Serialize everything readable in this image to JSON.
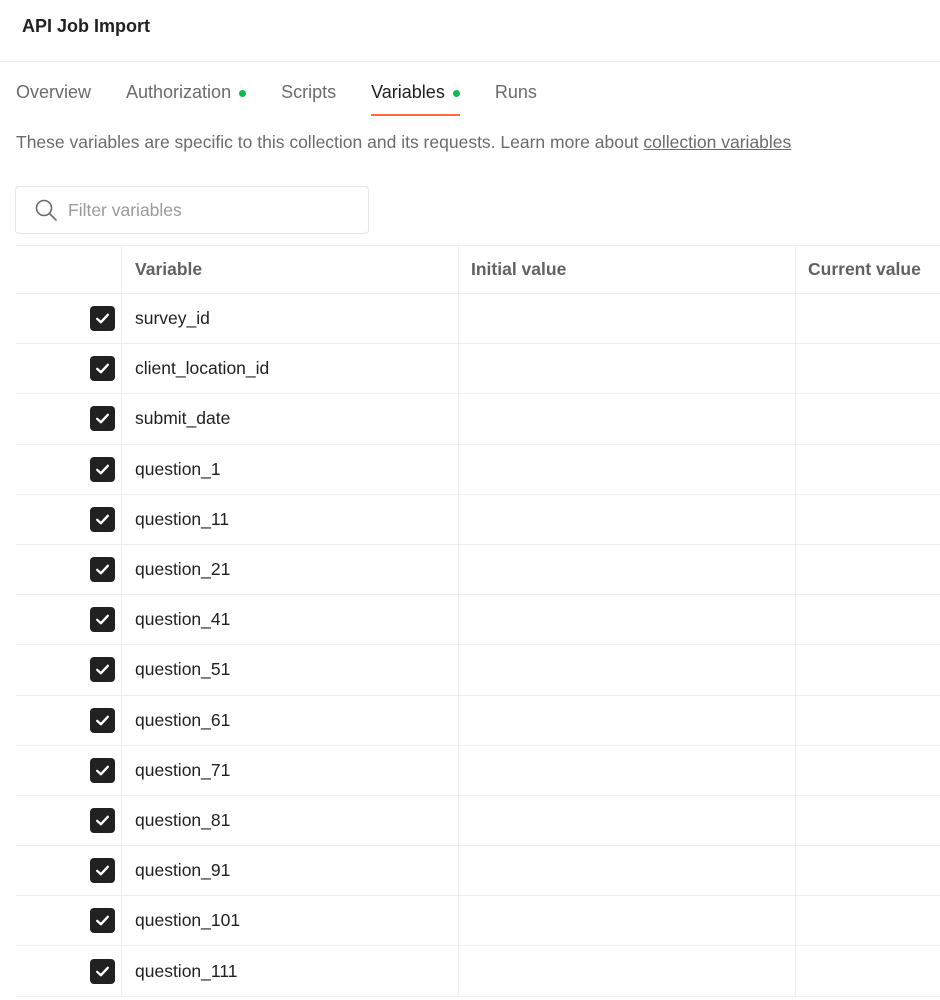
{
  "header": {
    "title": "API Job Import"
  },
  "tabs": [
    {
      "label": "Overview",
      "dot": false,
      "active": false
    },
    {
      "label": "Authorization",
      "dot": true,
      "active": false
    },
    {
      "label": "Scripts",
      "dot": false,
      "active": false
    },
    {
      "label": "Variables",
      "dot": true,
      "active": true
    },
    {
      "label": "Runs",
      "dot": false,
      "active": false
    }
  ],
  "description": {
    "text": "These variables are specific to this collection and its requests. Learn more about ",
    "link": "collection variables"
  },
  "filter": {
    "placeholder": "Filter variables",
    "value": ""
  },
  "table": {
    "columns": [
      "Variable",
      "Initial value",
      "Current value"
    ],
    "rows": [
      {
        "checked": true,
        "variable": "survey_id",
        "initial": "",
        "current": ""
      },
      {
        "checked": true,
        "variable": "client_location_id",
        "initial": "",
        "current": ""
      },
      {
        "checked": true,
        "variable": "submit_date",
        "initial": "",
        "current": ""
      },
      {
        "checked": true,
        "variable": "question_1",
        "initial": "",
        "current": ""
      },
      {
        "checked": true,
        "variable": "question_11",
        "initial": "",
        "current": ""
      },
      {
        "checked": true,
        "variable": "question_21",
        "initial": "",
        "current": ""
      },
      {
        "checked": true,
        "variable": "question_41",
        "initial": "",
        "current": ""
      },
      {
        "checked": true,
        "variable": "question_51",
        "initial": "",
        "current": ""
      },
      {
        "checked": true,
        "variable": "question_61",
        "initial": "",
        "current": ""
      },
      {
        "checked": true,
        "variable": "question_71",
        "initial": "",
        "current": ""
      },
      {
        "checked": true,
        "variable": "question_81",
        "initial": "",
        "current": ""
      },
      {
        "checked": true,
        "variable": "question_91",
        "initial": "",
        "current": ""
      },
      {
        "checked": true,
        "variable": "question_101",
        "initial": "",
        "current": ""
      },
      {
        "checked": true,
        "variable": "question_111",
        "initial": "",
        "current": ""
      }
    ]
  },
  "colors": {
    "accent": "#ff6c37",
    "status_dot": "#0cbb52",
    "checkbox": "#212121"
  },
  "icons": {
    "search": "search-icon",
    "check": "check-icon"
  }
}
